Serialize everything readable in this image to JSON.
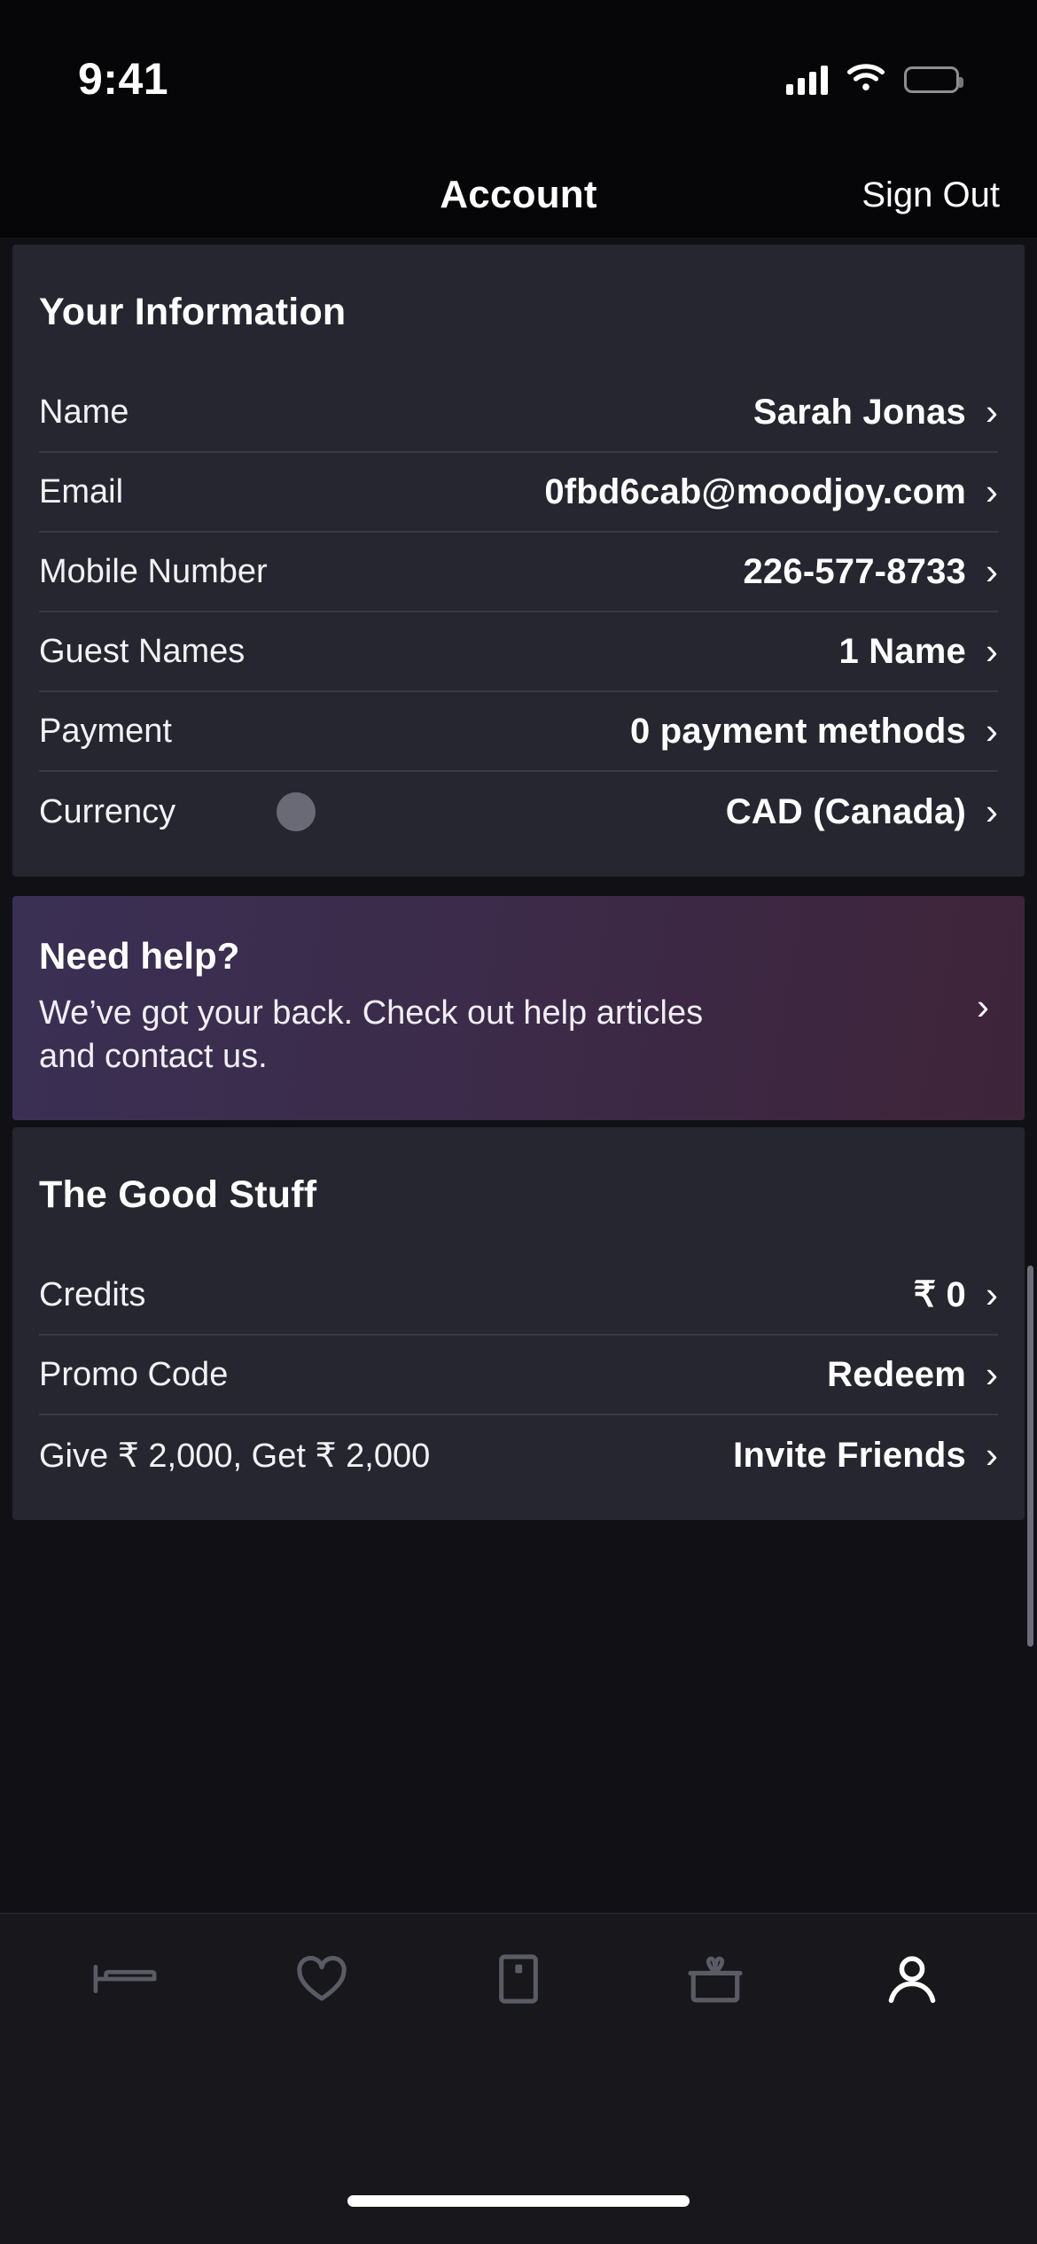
{
  "status_bar": {
    "time": "9:41",
    "cellular_icon": "cellular-bars-icon",
    "wifi_icon": "wifi-icon",
    "battery_icon": "battery-full-icon"
  },
  "header": {
    "title": "Account",
    "action_label": "Sign Out"
  },
  "your_information": {
    "title": "Your Information",
    "rows": [
      {
        "label": "Name",
        "value": "Sarah Jonas"
      },
      {
        "label": "Email",
        "value": "0fbd6cab@moodjoy.com"
      },
      {
        "label": "Mobile Number",
        "value": "226-577-8733"
      },
      {
        "label": "Guest Names",
        "value": "1 Name"
      },
      {
        "label": "Payment",
        "value": "0 payment methods"
      },
      {
        "label": "Currency",
        "value": "CAD (Canada)"
      }
    ]
  },
  "help_card": {
    "title": "Need help?",
    "subtitle": "We’ve got your back. Check out help articles and contact us.",
    "chevron": "›"
  },
  "good_stuff": {
    "title": "The Good Stuff",
    "rows": [
      {
        "label": "Credits",
        "value": "₹ 0"
      },
      {
        "label": "Promo Code",
        "value": "Redeem"
      },
      {
        "label": "Give ₹ 2,000, Get ₹ 2,000",
        "value": "Invite Friends"
      }
    ]
  },
  "chevron_glyph": "›",
  "tab_bar": {
    "items": [
      {
        "name": "stays",
        "icon": "bed-icon",
        "active": false
      },
      {
        "name": "wishlist",
        "icon": "heart-icon",
        "active": false
      },
      {
        "name": "trips",
        "icon": "door-icon",
        "active": false
      },
      {
        "name": "rewards",
        "icon": "gift-icon",
        "active": false
      },
      {
        "name": "account",
        "icon": "person-icon",
        "active": true
      }
    ]
  },
  "colors": {
    "page_bg": "#17171c",
    "card_bg": "#262630",
    "divider": "#3a3a45",
    "accent_purple": "#3a3054",
    "touch_dot": "#6a6a76",
    "tab_inactive": "#5b5b66",
    "tab_active": "#ffffff"
  }
}
